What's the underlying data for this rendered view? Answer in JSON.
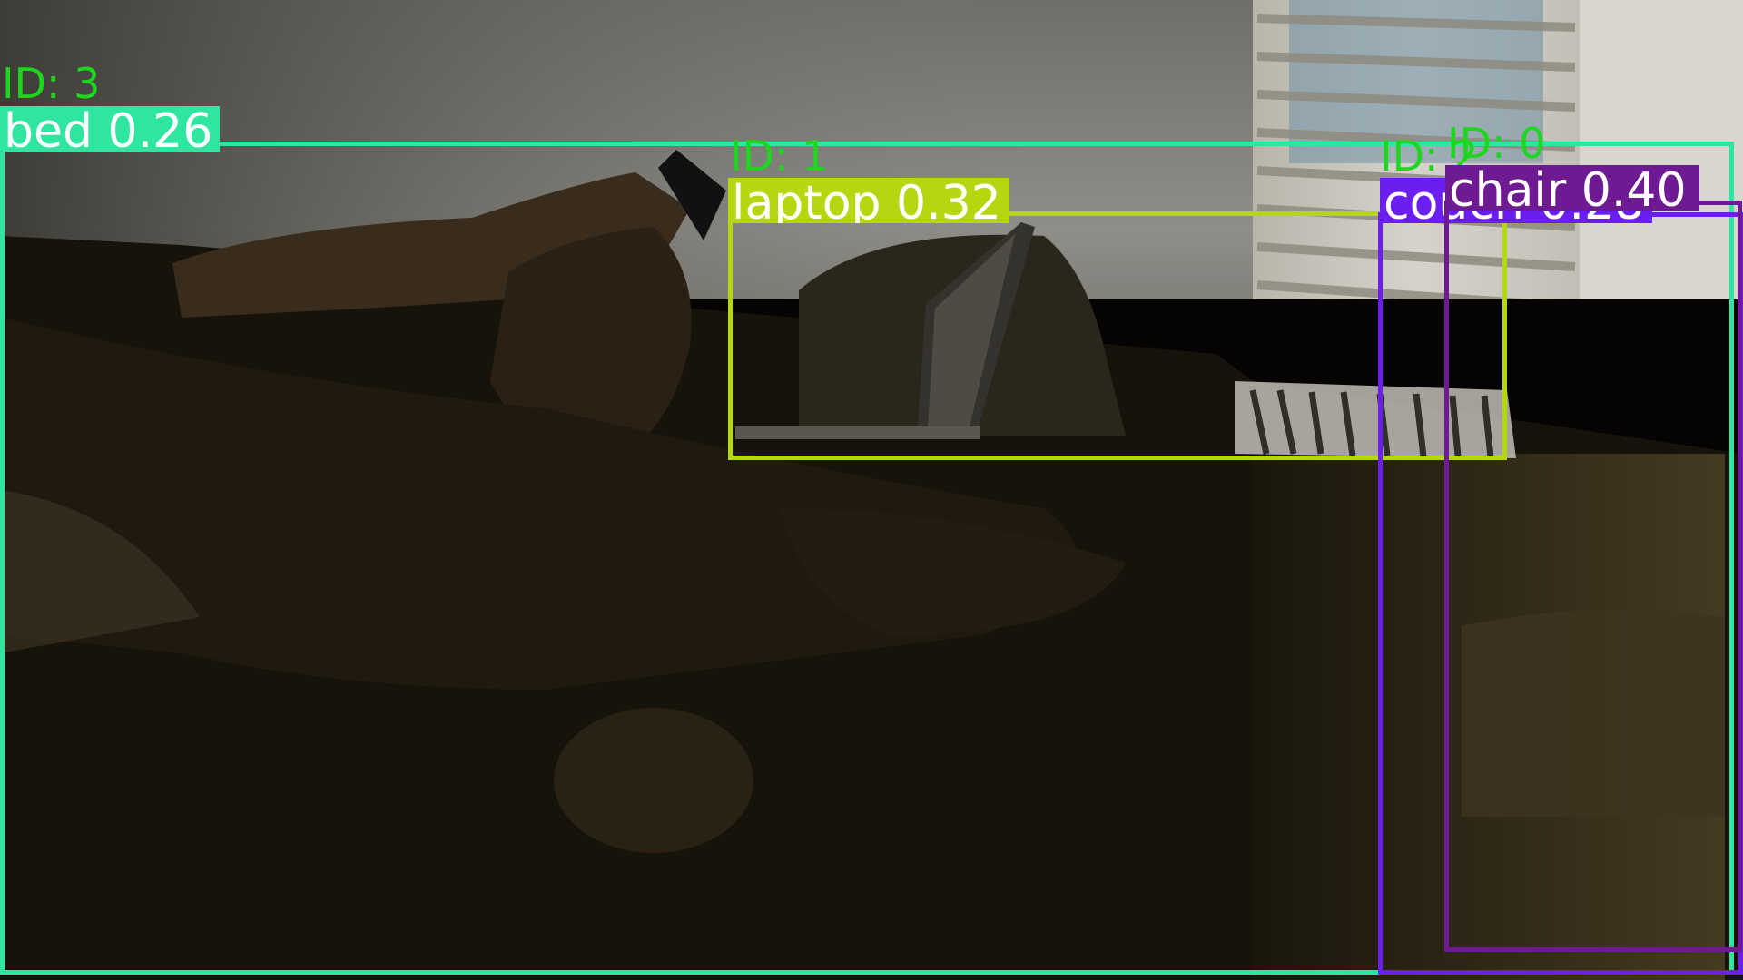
{
  "photo": {
    "description_icon": "dim-room-photo",
    "colors": {
      "wall": "#8e8d87",
      "dark": "#0c0a05",
      "couch": "#2a2415",
      "blind_highlight": "#c9c6bd",
      "window_blue": "#6f8fa6"
    }
  },
  "detections": [
    {
      "id_text": "ID: 3",
      "label": "bed 0.26",
      "color": "#2ee6a0"
    },
    {
      "id_text": "ID: 1",
      "label": "laptop 0.32",
      "color": "#b5d70f"
    },
    {
      "id_text": "ID: 2",
      "label": "couch 0.28",
      "color": "#6a1ff0"
    },
    {
      "id_text": "ID: 0",
      "label": "chair 0.40",
      "color": "#6e1a92"
    }
  ]
}
